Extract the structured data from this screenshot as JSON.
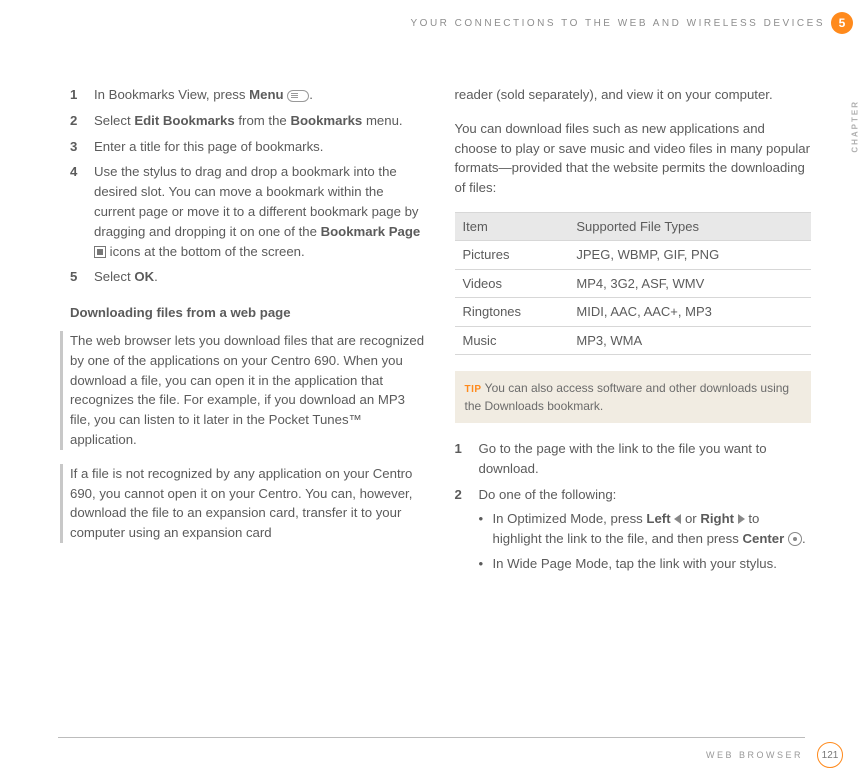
{
  "header": {
    "running_title": "YOUR CONNECTIONS TO THE WEB AND WIRELESS DEVICES"
  },
  "chapter": {
    "number": "5",
    "label": "CHAPTER"
  },
  "left_column": {
    "steps_a": [
      {
        "pre": "In Bookmarks View, press ",
        "bold1": "Menu",
        "post1": " ",
        "icon": "menu",
        "post2": "."
      },
      {
        "pre": "Select ",
        "bold1": "Edit Bookmarks",
        "mid": " from the ",
        "bold2": "Bookmarks",
        "post": " menu."
      },
      {
        "text": "Enter a title for this page of bookmarks."
      },
      {
        "pre": "Use the stylus to drag and drop a bookmark into the desired slot. You can move a bookmark within the current page or move it to a different bookmark page by dragging and dropping it on one of the ",
        "bold1": "Bookmark Page",
        "post1": " ",
        "icon": "page",
        "post2": " icons at the bottom of the screen."
      },
      {
        "pre": "Select ",
        "bold1": "OK",
        "post": "."
      }
    ],
    "subhead": "Downloading files from a web page",
    "para1": "The web browser lets you download files that are recognized by one of the applications on your Centro 690. When you download a file, you can open it in the application that recognizes the file. For example, if you download an MP3 file, you can listen to it later in the Pocket Tunes™ application.",
    "para2": "If a file is not recognized by any application on your Centro 690, you cannot open it on your Centro. You can, however, download the file to an expansion card, transfer it to your computer using an expansion card"
  },
  "right_column": {
    "para1": "reader (sold separately), and view it on your computer.",
    "para2": "You can download files such as new applications and choose to play or save music and video files in many popular formats—provided that the website permits the downloading of files:",
    "table": {
      "headers": [
        "Item",
        "Supported File Types"
      ],
      "rows": [
        [
          "Pictures",
          "JPEG, WBMP, GIF, PNG"
        ],
        [
          "Videos",
          "MP4, 3G2, ASF, WMV"
        ],
        [
          "Ringtones",
          "MIDI, AAC, AAC+, MP3"
        ],
        [
          "Music",
          "MP3, WMA"
        ]
      ]
    },
    "tip": {
      "label": "TIP",
      "text": " You can also access software and other downloads using the Downloads bookmark."
    },
    "steps_b": {
      "s1": "Go to the page with the link to the file you want to download.",
      "s2_intro": "Do one of the following:",
      "s2_b1_pre": "In Optimized Mode, press ",
      "s2_b1_left": "Left",
      "s2_b1_or": " or ",
      "s2_b1_right": "Right",
      "s2_b1_mid": " to highlight the link to the file, and then press ",
      "s2_b1_center": "Center",
      "s2_b1_post": " .",
      "s2_b2": "In Wide Page Mode, tap the link with your stylus."
    }
  },
  "footer": {
    "section": "WEB BROWSER",
    "page": "121"
  }
}
